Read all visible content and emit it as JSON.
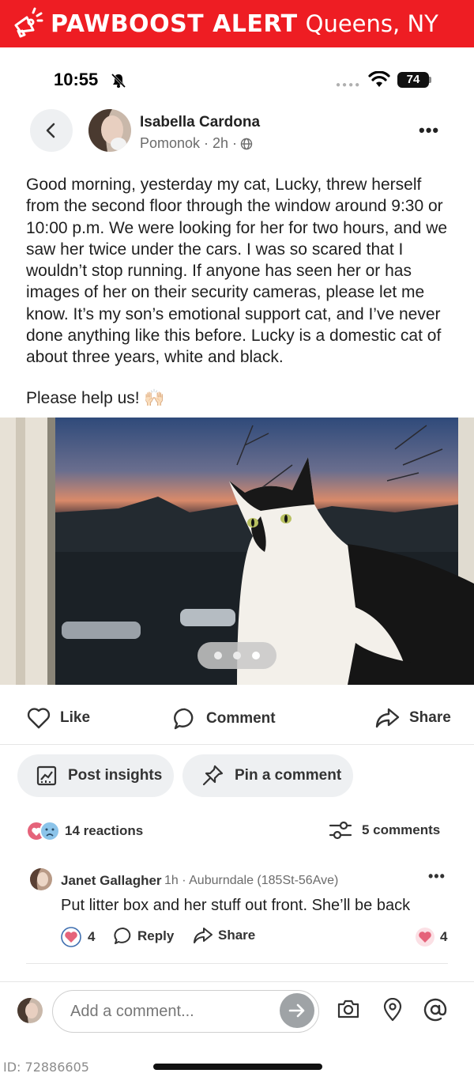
{
  "banner": {
    "brand": "PAWBOOST ALERT",
    "location": "Queens, NY",
    "icon": "megaphone-icon",
    "color": "#ee1d23"
  },
  "status_bar": {
    "time": "10:55",
    "battery": "74",
    "icons": [
      "bell-slash-icon",
      "cellular-dots-icon",
      "wifi-icon",
      "battery-icon"
    ]
  },
  "post": {
    "author": "Isabella Cardona",
    "meta": "Pomonok · 2h ·",
    "privacy_icon": "globe-icon",
    "body": "Good morning, yesterday my cat, Lucky, threw herself from the second floor through the window around 9:30 or 10:00 p.m. We were looking for her for two hours, and we saw her twice under the cars. I was so scared that I wouldn’t stop running. If anyone has seen her or has images of her on their security cameras, please let me know. It’s my son’s emotional support cat, and I’ve never done anything like this before. Lucky is a domestic cat of about three years, white and black.",
    "help": "Please help us! 🙌🏻",
    "photo_pages": 3,
    "photo_active_page": 3
  },
  "actions": {
    "like": "Like",
    "comment": "Comment",
    "share": "Share"
  },
  "tools": {
    "post_insights": "Post insights",
    "pin_comment": "Pin a comment"
  },
  "stats": {
    "reactions": "14 reactions",
    "comments": "5 comments"
  },
  "comment": {
    "author": "Janet Gallagher",
    "meta": "1h · Auburndale (185St-56Ave)",
    "text": "Put litter box and her stuff out front. She’ll be back",
    "like_count": "4",
    "reply": "Reply",
    "share": "Share",
    "reaction_count": "4"
  },
  "composer": {
    "placeholder": "Add a comment...",
    "icons": [
      "camera-icon",
      "location-pin-icon",
      "at-sign-icon"
    ]
  },
  "footer": {
    "id": "ID: 72886605"
  }
}
